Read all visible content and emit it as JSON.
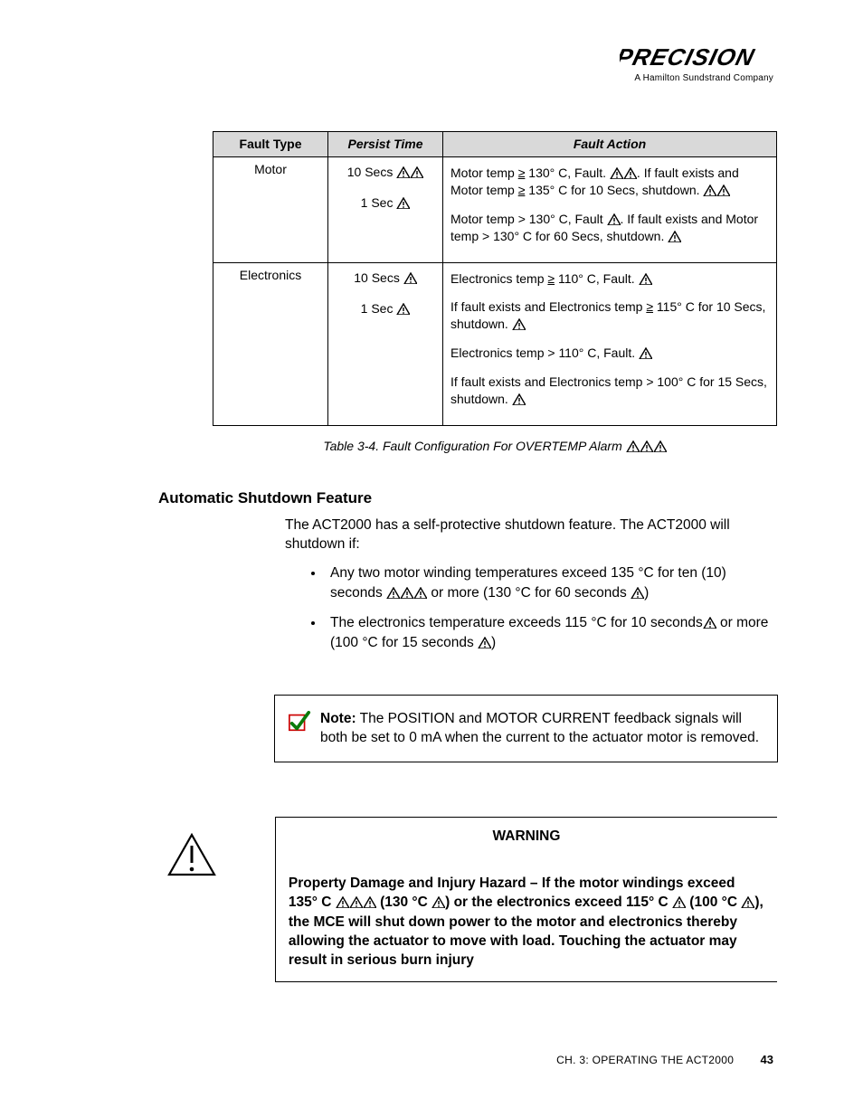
{
  "header": {
    "logo_text": "PRECISION",
    "tagline": "A Hamilton Sundstrand Company"
  },
  "table": {
    "headers": {
      "col1": "Fault Type",
      "col2": "Persist Time",
      "col3": "Fault Action"
    },
    "row_motor": {
      "type": "Motor",
      "pt1": "10 Secs ",
      "pt2": "1 Sec ",
      "fa1a": "Motor temp ",
      "fa1b": " 130° C, Fault. ",
      "fa1c": ". If fault exists and Motor temp ",
      "fa1d": " 135° C for 10 Secs, shutdown. ",
      "fa2a": "Motor temp > 130° C, Fault  ",
      "fa2b": ". If fault exists and Motor temp > 130° C for 60 Secs, shutdown. "
    },
    "row_elec": {
      "type": "Electronics",
      "pt1": "10 Secs ",
      "pt2": "1 Sec ",
      "fa1a": "Electronics temp ",
      "fa1b": " 110° C, Fault. ",
      "fa2a": "If fault exists and Electronics temp ",
      "fa2b": " 115° C for 10 Secs, shutdown. ",
      "fa3": "Electronics temp > 110° C, Fault. ",
      "fa4": "If fault exists and Electronics temp > 100° C for 15 Secs, shutdown. "
    },
    "caption": "Table 3-4.  Fault Configuration For OVERTEMP Alarm  "
  },
  "section_heading": "Automatic Shutdown Feature",
  "intro": "The ACT2000 has a self-protective shutdown feature. The ACT2000 will shutdown if:",
  "bullet1a": "Any two motor winding temperatures exceed 135 °C for ten (10) seconds ",
  "bullet1b": " or more (130 °C for 60 seconds  ",
  "bullet1c": ")",
  "bullet2a": "The electronics temperature exceeds 115 °C for 10 seconds",
  "bullet2b": " or more (100 °C for 15 seconds ",
  "bullet2c": ")",
  "note_label": "Note:",
  "note_text": " The POSITION and MOTOR CURRENT feedback signals will both be set to 0 mA when the current to the actuator motor is removed.",
  "warning_title": "WARNING",
  "warning_body1": "Property Damage and Injury Hazard – If the motor windings exceed 135° C ",
  "warning_body2": " (130 °C ",
  "warning_body3": ") or the electronics exceed 115° C ",
  "warning_body4": " (100 °C ",
  "warning_body5": "), the MCE will shut down power to the motor and electronics thereby allowing the actuator to move with load. Touching the actuator may result in serious burn injury",
  "footer_chapter": "CH. 3: OPERATING THE ACT2000",
  "footer_page": "43",
  "gte": "≥"
}
